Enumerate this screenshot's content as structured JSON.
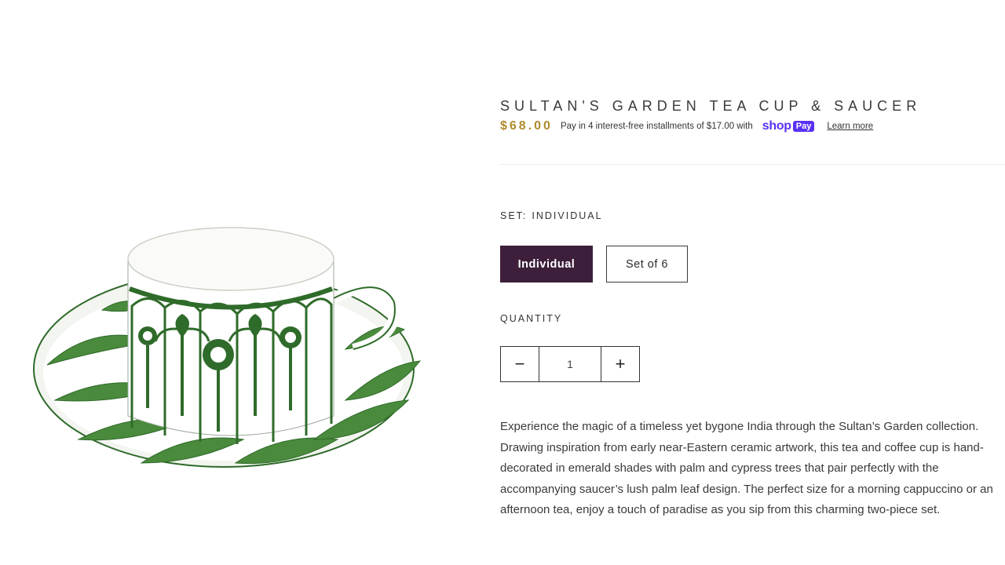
{
  "product": {
    "title": "Sultan's Garden Tea Cup & Saucer",
    "price": "$68.00",
    "installments_text": "Pay in 4 interest-free installments of $17.00 with",
    "shop_pay": {
      "shop": "shop",
      "pay": "Pay"
    },
    "learn_more": "Learn more"
  },
  "set": {
    "label": "SET:",
    "selected": "INDIVIDUAL",
    "options": [
      "Individual",
      "Set of 6"
    ]
  },
  "quantity": {
    "label": "QUANTITY",
    "value": "1",
    "minus": "−",
    "plus": "+"
  },
  "description": "Experience the magic of a timeless yet bygone India through the Sultan’s Garden collection. Drawing inspiration from early near-Eastern ceramic artwork, this tea and coffee cup is hand-decorated in emerald shades with palm and cypress trees that pair perfectly with the accompanying saucer’s lush palm leaf design. The perfect size for a morning cappuccino or an afternoon tea, enjoy a touch of paradise as you sip from this charming two-piece set.",
  "colors": {
    "price": "#b08a2e",
    "selected_option_bg": "#3d1f3c",
    "shop_pay": "#5a31f4",
    "emerald": "#2f6b2a"
  }
}
